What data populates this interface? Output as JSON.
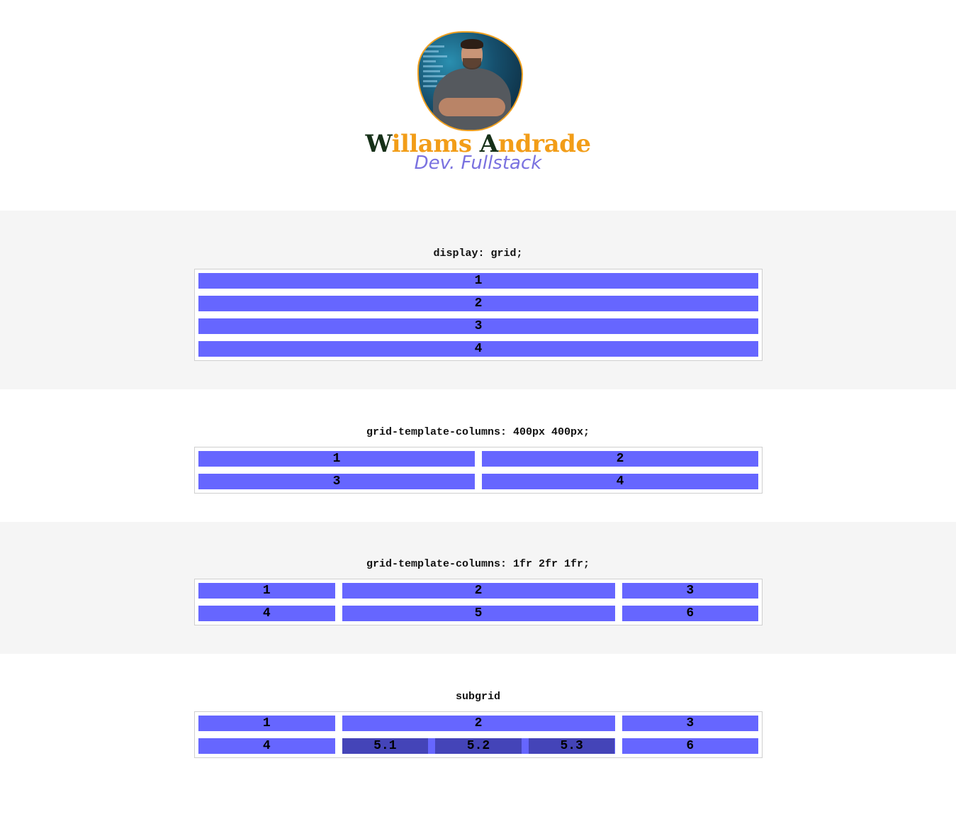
{
  "profile": {
    "name_initial_1": "W",
    "name_rest_1": "illams ",
    "name_initial_2": "A",
    "name_rest_2": "ndrade",
    "role": "Dev. Fullstack"
  },
  "sections": [
    {
      "title": "display: grid;",
      "items": [
        "1",
        "2",
        "3",
        "4"
      ]
    },
    {
      "title": "grid-template-columns: 400px 400px;",
      "items": [
        "1",
        "2",
        "3",
        "4"
      ]
    },
    {
      "title": "grid-template-columns: 1fr 2fr 1fr;",
      "items": [
        "1",
        "2",
        "3",
        "4",
        "5",
        "6"
      ]
    },
    {
      "title": "subgrid",
      "items": [
        "1",
        "2",
        "3",
        "4",
        "6"
      ],
      "sub_items": [
        "5.1",
        "5.2",
        "5.3"
      ]
    }
  ],
  "colors": {
    "cell": "#6666ff",
    "subcell": "#4444b8",
    "accent": "#f29d18",
    "dark_initial": "#163018",
    "role": "#7a72e0",
    "section_gray": "#f5f5f5"
  }
}
